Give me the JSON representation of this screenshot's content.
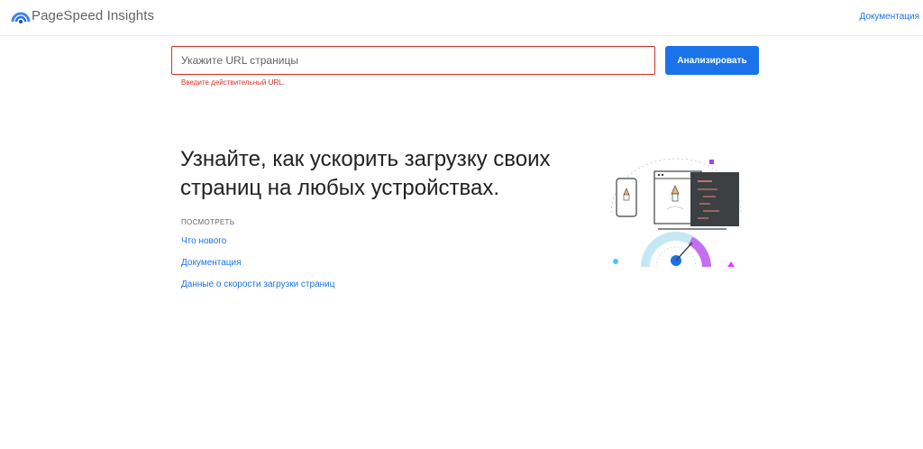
{
  "header": {
    "brand": "PageSpeed Insights",
    "docs_link": "Документация"
  },
  "search": {
    "placeholder": "Укажите URL страницы",
    "value": "",
    "error": "Введите действительный URL.",
    "button_label": "Анализировать"
  },
  "main": {
    "headline": "Узнайте, как ускорить загрузку своих страниц на любых устройствах.",
    "view_label": "ПОСМОТРЕТЬ",
    "links": [
      "Что нового",
      "Документация",
      "Данные о скорости загрузки страниц"
    ]
  },
  "colors": {
    "accent": "#1a73e8",
    "error": "#d93025",
    "purple": "#c36ff0",
    "cyan": "#4fc3f7"
  },
  "icons": {
    "logo": "pagespeed-gauge-icon",
    "illustration": "rocket-speed-illustration"
  }
}
